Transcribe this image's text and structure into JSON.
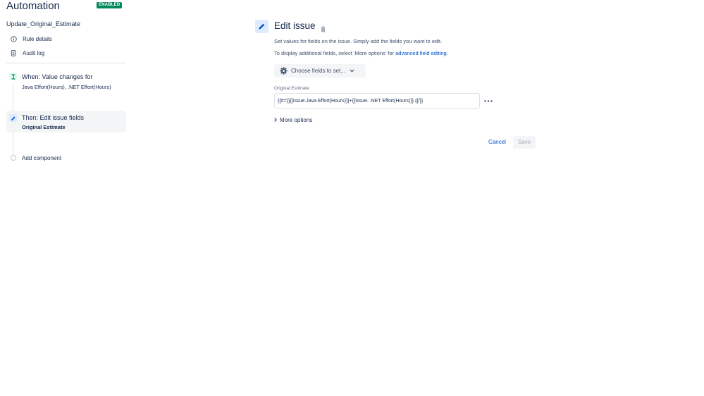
{
  "app": {
    "title": "Automation",
    "status_badge": "ENABLED"
  },
  "rule": {
    "name": "Update_Original_Estimate"
  },
  "nav": {
    "items": [
      {
        "label": "Rule details",
        "icon": "info-icon"
      },
      {
        "label": "Audit log",
        "icon": "document-icon"
      }
    ]
  },
  "flow": {
    "trigger": {
      "title": "When: Value changes for",
      "subtitle": "Java Effort(Hours), .NET Effort(Hours)",
      "icon": "trigger-icon"
    },
    "action": {
      "title": "Then: Edit issue fields",
      "subtitle": "Original Estimate",
      "icon": "pencil-icon"
    },
    "add_label": "Add component"
  },
  "panel": {
    "title": "Edit issue",
    "desc1": "Set values for fields on the issue. Simply add the fields you want to edit.",
    "desc2_prefix": "To display additional fields, select 'More options' for ",
    "desc2_link": "advanced field editing",
    "desc2_suffix": ".",
    "choose_label": "Choose fields to set...",
    "field": {
      "label": "Original Estimate",
      "value": "{{#=}}{{issue.Java Effort(Hours)}}+{{issue. .NET Effort(Hours)}} {{/}}"
    },
    "more_options": "More options",
    "cancel": "Cancel",
    "save": "Save"
  },
  "colors": {
    "badge_green": "#00875a",
    "link_blue": "#0052cc",
    "trigger_green": "#57d9a3",
    "action_blue": "#0052cc",
    "selected_bg": "#f4f5f7"
  }
}
